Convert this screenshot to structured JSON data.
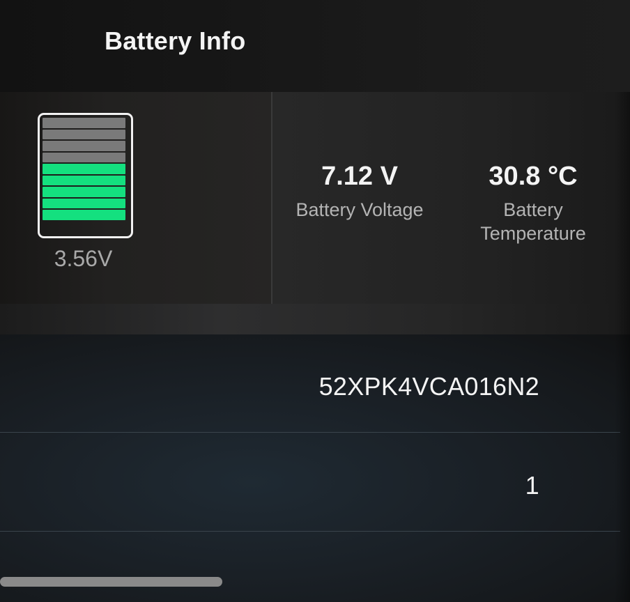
{
  "header": {
    "title": "Battery Info"
  },
  "battery_gauge": {
    "total_segments": 9,
    "filled_segments": 5,
    "filled_color": "#14e07f",
    "empty_color": "#7a7a7a",
    "cell_voltage": "3.56V"
  },
  "stats": [
    {
      "value": "7.12 V",
      "label": "Battery Voltage"
    },
    {
      "value": "30.8 °C",
      "label": "Battery Temperature",
      "label_line1": "Battery",
      "label_line2": "Temperature"
    }
  ],
  "rows": [
    {
      "value": "52XPK4VCA016N2"
    },
    {
      "value": "1"
    }
  ]
}
